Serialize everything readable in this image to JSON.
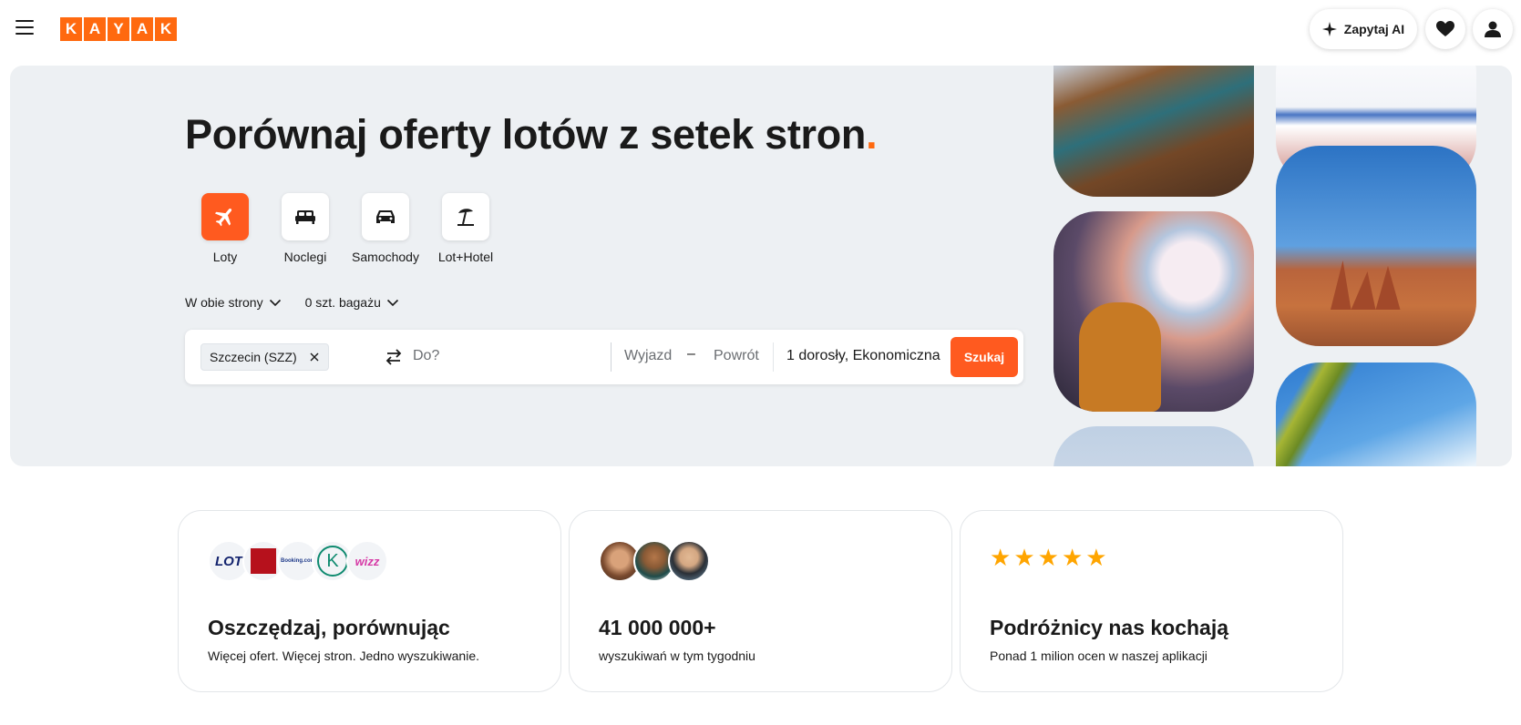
{
  "header": {
    "logo_letters": [
      "K",
      "A",
      "Y",
      "A",
      "K"
    ],
    "ai_button": "Zapytaj AI",
    "icons": [
      "menu-icon",
      "sparkle-icon",
      "heart-icon",
      "user-icon"
    ]
  },
  "hero": {
    "title": "Porównaj oferty lotów z setek stron",
    "title_dot": ".",
    "verticals": [
      {
        "label": "Loty",
        "icon": "plane-icon",
        "active": true
      },
      {
        "label": "Noclegi",
        "icon": "bed-icon",
        "active": false
      },
      {
        "label": "Samochody",
        "icon": "car-icon",
        "active": false
      },
      {
        "label": "Lot+Hotel",
        "icon": "beach-icon",
        "active": false
      }
    ],
    "trip_type": "W obie strony",
    "bags": "0 szt. bagażu",
    "search": {
      "origin": "Szczecin (SZZ)",
      "destination_placeholder": "Do?",
      "depart_placeholder": "Wyjazd",
      "dash": "–",
      "return_placeholder": "Powrót",
      "travelers": "1 dorosły, Ekonomiczna",
      "button": "Szukaj"
    }
  },
  "cards": [
    {
      "title": "Oszczędzaj, porównując",
      "subtitle": "Więcej ofert. Więcej stron. Jedno wyszukiwanie.",
      "partner_logos": [
        "LOT",
        "",
        "Booking.com",
        "K",
        "wizz"
      ]
    },
    {
      "title": "41 000 000+",
      "subtitle": "wyszukiwań w tym tygodniu"
    },
    {
      "title": "Podróżnicy nas kochają",
      "subtitle": "Ponad 1 milion ocen w naszej aplikacji",
      "rating_stars": 5
    }
  ],
  "colors": {
    "accent": "#ff690f",
    "search_button": "#ff5a1f",
    "hero_bg": "#edf0f3",
    "stars": "#ffa500"
  }
}
